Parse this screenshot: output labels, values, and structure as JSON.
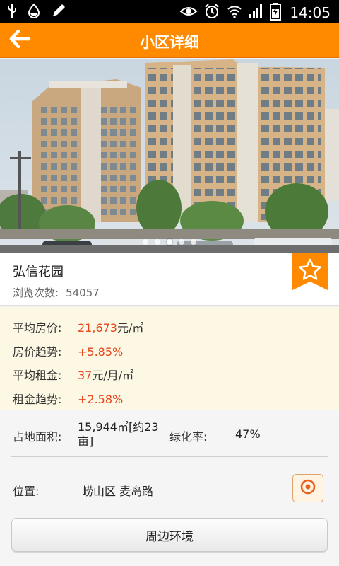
{
  "status_bar": {
    "time": "14:05",
    "icons": [
      "usb-icon",
      "water-drop-icon",
      "pen-icon",
      "eye-icon",
      "alarm-icon",
      "wifi-icon",
      "signal-icon",
      "battery-icon"
    ]
  },
  "header": {
    "title": "小区详细",
    "back_icon": "arrow-left-icon",
    "color": "#ff8a00"
  },
  "gallery": {
    "page_count": 5,
    "active_index": 2
  },
  "estate": {
    "name": "弘信花园",
    "views_label": "浏览次数:",
    "views_value": "54057",
    "favorite_icon": "star-icon"
  },
  "prices": {
    "avg_price_label": "平均房价:",
    "avg_price_value": "21,673",
    "avg_price_unit": "元/㎡",
    "price_trend_label": "房价趋势:",
    "price_trend_value": "+5.85%",
    "avg_rent_label": "平均租金:",
    "avg_rent_value": "37",
    "avg_rent_unit": "元/月/㎡",
    "rent_trend_label": "租金趋势:",
    "rent_trend_value": "+2.58%",
    "highlight_color": "#e8451d"
  },
  "info": {
    "area_label": "占地面积:",
    "area_value": "15,944㎡[约23亩]",
    "green_label": "绿化率:",
    "green_value": "47%",
    "location_label": "位置:",
    "location_value": "崂山区  麦岛路",
    "location_icon": "map-target-icon"
  },
  "actions": {
    "surroundings_label": "周边环境"
  }
}
